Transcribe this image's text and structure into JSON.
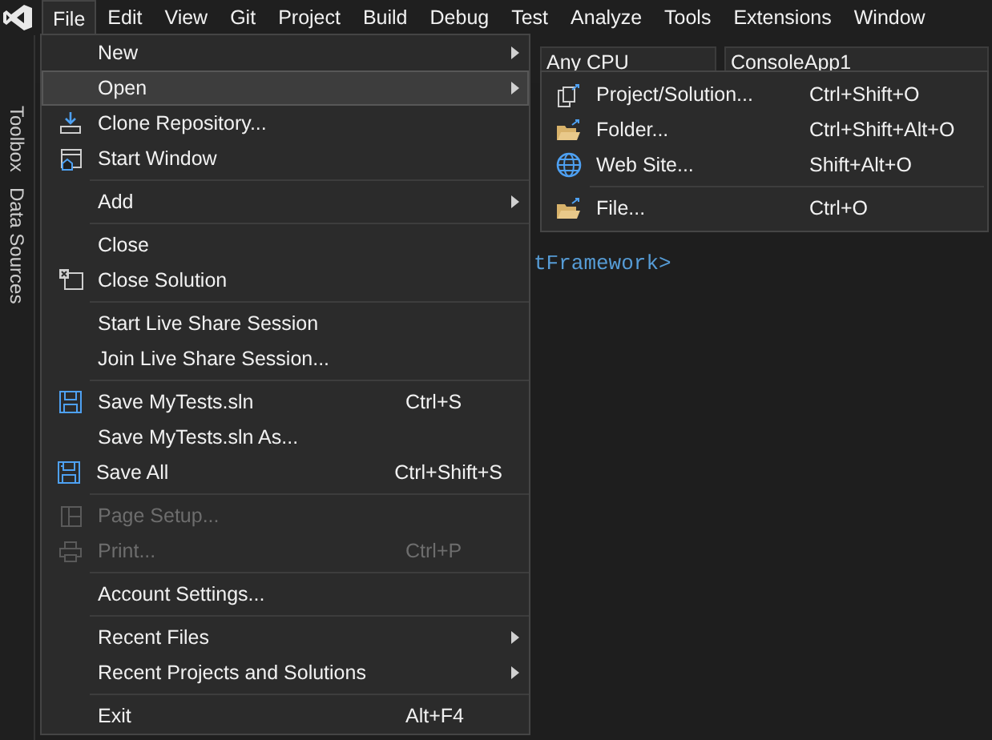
{
  "menu_bar": [
    {
      "label": "File",
      "selected": true
    },
    {
      "label": "Edit",
      "selected": false
    },
    {
      "label": "View",
      "selected": false
    },
    {
      "label": "Git",
      "selected": false
    },
    {
      "label": "Project",
      "selected": false
    },
    {
      "label": "Build",
      "selected": false
    },
    {
      "label": "Debug",
      "selected": false
    },
    {
      "label": "Test",
      "selected": false
    },
    {
      "label": "Analyze",
      "selected": false
    },
    {
      "label": "Tools",
      "selected": false
    },
    {
      "label": "Extensions",
      "selected": false
    },
    {
      "label": "Window",
      "selected": false
    }
  ],
  "toolbar": {
    "platform": "Any CPU",
    "startup_project": "ConsoleApp1"
  },
  "side_tabs": [
    "Toolbox",
    "Data Sources"
  ],
  "editor": {
    "code": "tFramework>"
  },
  "file_menu": [
    {
      "kind": "item",
      "label": "New",
      "submenu": true,
      "selected": false,
      "disabled": false
    },
    {
      "kind": "item",
      "label": "Open",
      "submenu": true,
      "selected": true,
      "disabled": false
    },
    {
      "kind": "item",
      "label": "Clone Repository...",
      "selected": false,
      "disabled": false
    },
    {
      "kind": "item",
      "label": "Start Window",
      "selected": false,
      "disabled": false
    },
    {
      "kind": "separator"
    },
    {
      "kind": "item",
      "label": "Add",
      "submenu": true,
      "selected": false,
      "disabled": false
    },
    {
      "kind": "separator"
    },
    {
      "kind": "item",
      "label": "Close",
      "selected": false,
      "disabled": false
    },
    {
      "kind": "item",
      "label": "Close Solution",
      "selected": false,
      "disabled": false
    },
    {
      "kind": "separator"
    },
    {
      "kind": "item",
      "label": "Start Live Share Session",
      "selected": false,
      "disabled": false
    },
    {
      "kind": "item",
      "label": "Join Live Share Session...",
      "selected": false,
      "disabled": false
    },
    {
      "kind": "separator"
    },
    {
      "kind": "item",
      "label": "Save MyTests.sln",
      "shortcut": "Ctrl+S",
      "selected": false,
      "disabled": false
    },
    {
      "kind": "item",
      "label": "Save MyTests.sln As...",
      "selected": false,
      "disabled": false
    },
    {
      "kind": "item",
      "label": "Save All",
      "shortcut": "Ctrl+Shift+S",
      "selected": false,
      "disabled": false
    },
    {
      "kind": "separator"
    },
    {
      "kind": "item",
      "label": "Page Setup...",
      "selected": false,
      "disabled": true
    },
    {
      "kind": "item",
      "label": "Print...",
      "shortcut": "Ctrl+P",
      "selected": false,
      "disabled": true
    },
    {
      "kind": "separator"
    },
    {
      "kind": "item",
      "label": "Account Settings...",
      "selected": false,
      "disabled": false
    },
    {
      "kind": "separator"
    },
    {
      "kind": "item",
      "label": "Recent Files",
      "submenu": true,
      "selected": false,
      "disabled": false
    },
    {
      "kind": "item",
      "label": "Recent Projects and Solutions",
      "submenu": true,
      "selected": false,
      "disabled": false
    },
    {
      "kind": "separator"
    },
    {
      "kind": "item",
      "label": "Exit",
      "shortcut": "Alt+F4",
      "selected": false,
      "disabled": false
    }
  ],
  "open_submenu": [
    {
      "kind": "item",
      "label": "Project/Solution...",
      "shortcut": "Ctrl+Shift+O"
    },
    {
      "kind": "item",
      "label": "Folder...",
      "shortcut": "Ctrl+Shift+Alt+O"
    },
    {
      "kind": "item",
      "label": "Web Site...",
      "shortcut": "Shift+Alt+O"
    },
    {
      "kind": "separator"
    },
    {
      "kind": "item",
      "label": "File...",
      "shortcut": "Ctrl+O"
    }
  ]
}
